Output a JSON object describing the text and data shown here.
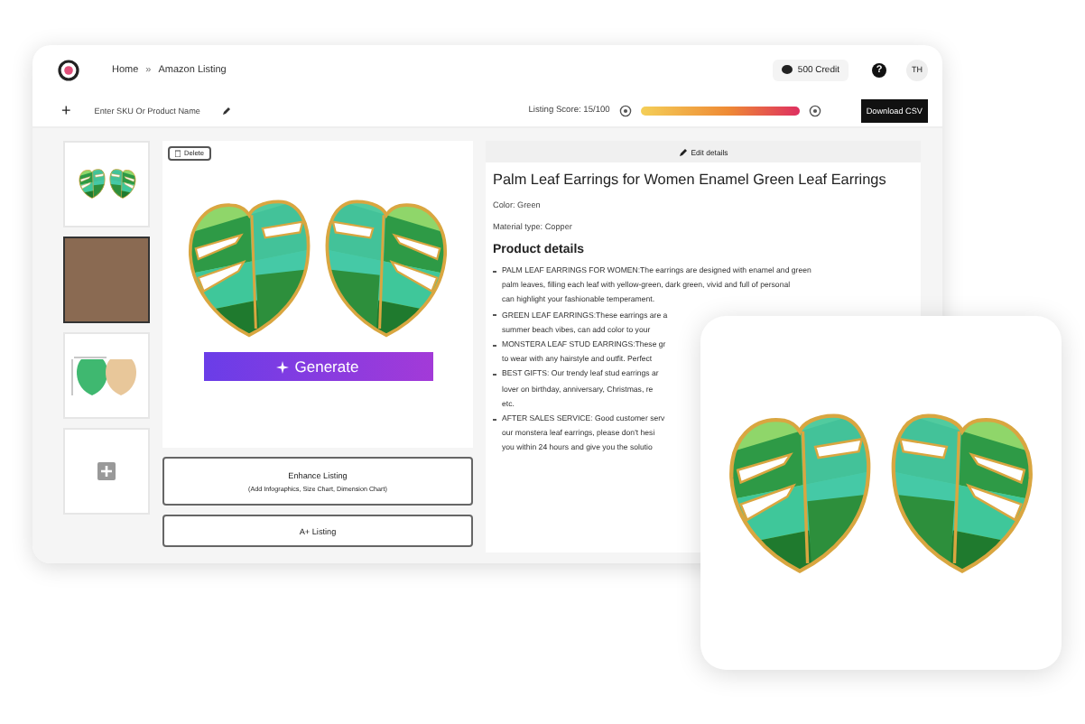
{
  "breadcrumb": {
    "home": "Home",
    "separator": "»",
    "current": "Amazon Listing"
  },
  "credits": "500 Credit",
  "help": "?",
  "avatar": "TH",
  "toolbar": {
    "add": "+",
    "sku_placeholder": "Enter SKU Or Product Name",
    "listing_score": "Listing Score: 15/100",
    "download": "Download CSV"
  },
  "thumbnails": [
    {
      "kind": "product"
    },
    {
      "kind": "photo"
    },
    {
      "kind": "infographic"
    },
    {
      "kind": "add"
    }
  ],
  "image_panel": {
    "delete": "Delete",
    "generate": "Generate"
  },
  "enhance": {
    "title": "Enhance Listing",
    "subtitle": "(Add Infographics, Size Chart, Dimension Chart)"
  },
  "aplus": "A+ Listing",
  "edit_details": "Edit details",
  "product": {
    "title": "Palm Leaf Earrings for Women Enamel Green Leaf Earrings",
    "attributes": [
      "Color:  Green",
      "Material type:  Copper"
    ],
    "details_heading": "Product details",
    "bullets": [
      {
        "lines": [
          "PALM LEAF EARRINGS FOR WOMEN:The earrings are designed with enamel and green",
          "palm leaves, filling each leaf with yellow-green, dark green, vivid and full of personal",
          "can highlight your fashionable temperament."
        ]
      },
      {
        "lines": [
          "GREEN LEAF EARRINGS:These earrings are a",
          "summer beach vibes, can add color to your"
        ]
      },
      {
        "lines": [
          "MONSTERA LEAF STUD EARRINGS:These gr",
          "to wear with any hairstyle and outfit. Perfect"
        ]
      },
      {
        "lines": [
          "BEST GIFTS: Our trendy leaf stud earrings ar",
          "lover on birthday, anniversary, Christmas, re",
          "etc."
        ]
      },
      {
        "lines": [
          "AFTER SALES SERVICE: Good customer serv",
          "our monstera leaf earrings, please don't hesi",
          "you within 24 hours and give you the solutio"
        ]
      }
    ]
  }
}
